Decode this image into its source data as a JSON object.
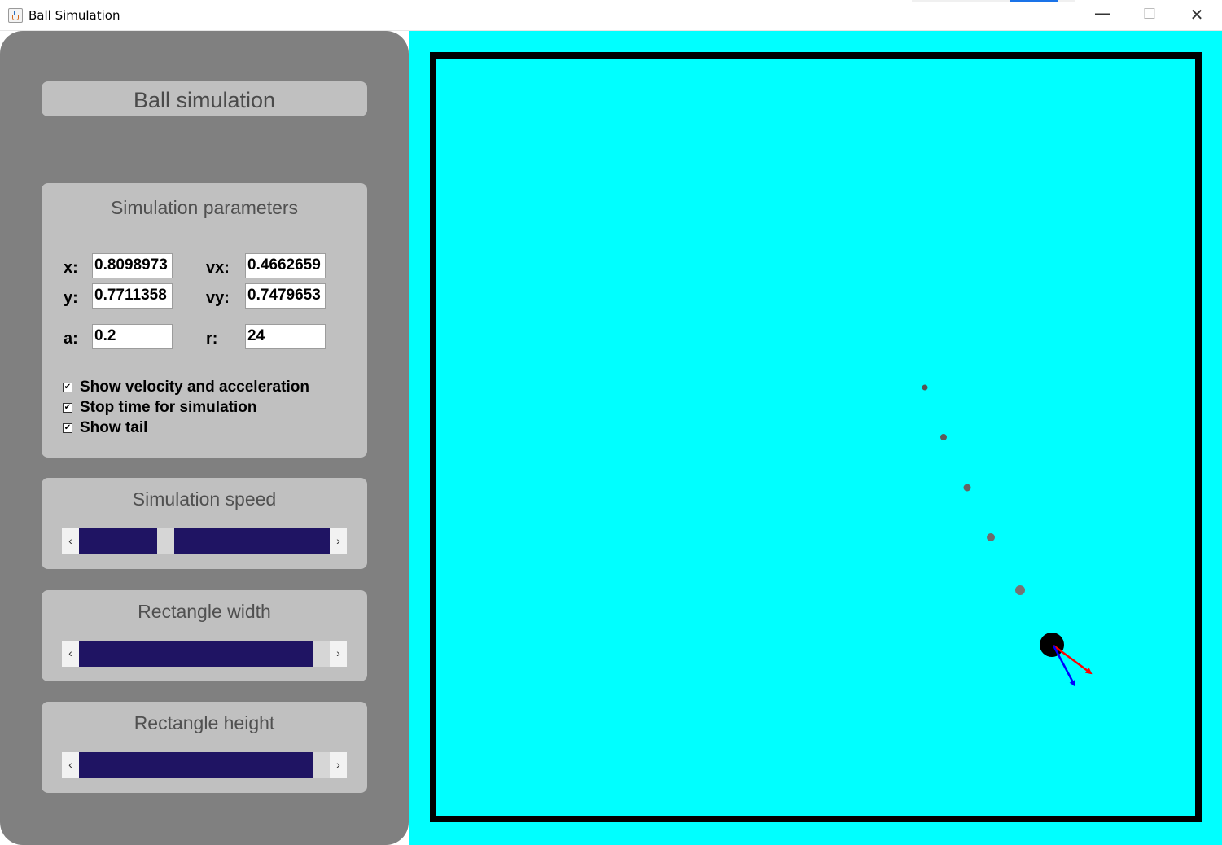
{
  "window": {
    "title": "Ball Simulation",
    "minimize": "—",
    "maximize": "☐",
    "close": "✕"
  },
  "panel": {
    "header": "Ball simulation",
    "params": {
      "title": "Simulation parameters",
      "x_label": "x:",
      "x_value": "0.8098973",
      "vx_label": "vx:",
      "vx_value": "0.4662659",
      "y_label": "y:",
      "y_value": "0.7711358",
      "vy_label": "vy:",
      "vy_value": "0.7479653",
      "a_label": "a:",
      "a_value": "0.2",
      "r_label": "r:",
      "r_value": "24",
      "checkboxes": [
        {
          "label": "Show velocity and acceleration",
          "checked": true
        },
        {
          "label": "Stop time for simulation",
          "checked": true
        },
        {
          "label": "Show tail",
          "checked": true
        }
      ]
    },
    "sliders": [
      {
        "title": "Simulation speed",
        "value_fraction": 0.35
      },
      {
        "title": "Rectangle width",
        "value_fraction": 0.93
      },
      {
        "title": "Rectangle height",
        "value_fraction": 0.93
      }
    ],
    "scroll_left_glyph": "‹",
    "scroll_right_glyph": "›"
  },
  "simulation": {
    "background_color": "#00ffff",
    "border_color": "#000000",
    "ball_color": "#000000",
    "tail_color": "#555555",
    "velocity_arrow_color": "#ff0000",
    "acceleration_arrow_color": "#0000ff"
  }
}
